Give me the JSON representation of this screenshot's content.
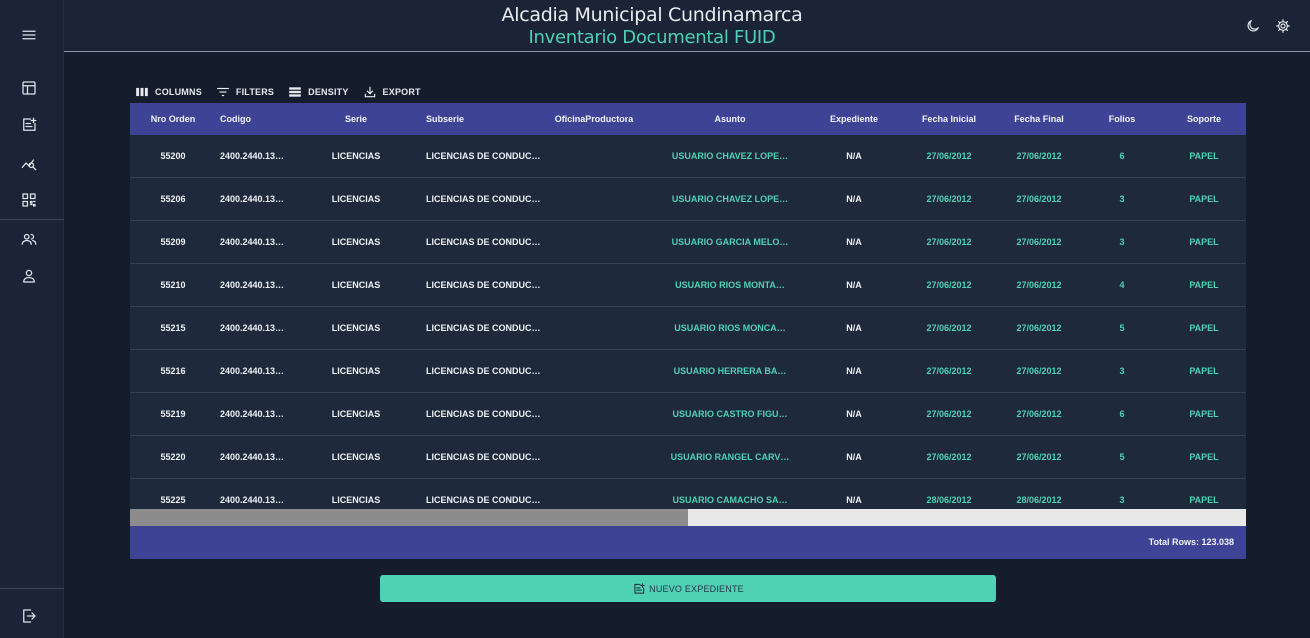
{
  "header": {
    "title": "Alcadia Municipal Cundinamarca",
    "subtitle": "Inventario Documental FUID"
  },
  "icons": {
    "menu": "menu-icon",
    "dashboard": "dashboard-icon",
    "new_record": "note-add-icon",
    "analytics": "chart-search-icon",
    "qr": "qr-code-icon",
    "users": "group-icon",
    "profile": "person-icon",
    "logout": "logout-icon",
    "theme": "moon-icon",
    "settings": "gear-icon"
  },
  "toolbar": {
    "columns_label": "COLUMNS",
    "filters_label": "FILTERS",
    "density_label": "DENSITY",
    "export_label": "EXPORT"
  },
  "table": {
    "columns": [
      "Nro Orden",
      "Codigo",
      "Serie",
      "Subserie",
      "OficinaProductora",
      "Asunto",
      "Expediente",
      "Fecha Inicial",
      "Fecha Final",
      "Folios",
      "Soporte"
    ],
    "rows": [
      [
        "55200",
        "2400.2440.13…",
        "LICENCIAS",
        "LICENCIAS DE CONDUC…",
        "",
        "USUARIO CHAVEZ LOPE…",
        "N/A",
        "27/06/2012",
        "27/06/2012",
        "6",
        "PAPEL"
      ],
      [
        "55206",
        "2400.2440.13…",
        "LICENCIAS",
        "LICENCIAS DE CONDUC…",
        "",
        "USUARIO CHAVEZ LOPE…",
        "N/A",
        "27/06/2012",
        "27/06/2012",
        "3",
        "PAPEL"
      ],
      [
        "55209",
        "2400.2440.13…",
        "LICENCIAS",
        "LICENCIAS DE CONDUC…",
        "",
        "USUARIO GARCIA MELO…",
        "N/A",
        "27/06/2012",
        "27/06/2012",
        "3",
        "PAPEL"
      ],
      [
        "55210",
        "2400.2440.13…",
        "LICENCIAS",
        "LICENCIAS DE CONDUC…",
        "",
        "USUARIO RIOS MONTA…",
        "N/A",
        "27/06/2012",
        "27/06/2012",
        "4",
        "PAPEL"
      ],
      [
        "55215",
        "2400.2440.13…",
        "LICENCIAS",
        "LICENCIAS DE CONDUC…",
        "",
        "USUARIO RIOS MONCA…",
        "N/A",
        "27/06/2012",
        "27/06/2012",
        "5",
        "PAPEL"
      ],
      [
        "55216",
        "2400.2440.13…",
        "LICENCIAS",
        "LICENCIAS DE CONDUC…",
        "",
        "USUARIO HERRERA BA…",
        "N/A",
        "27/06/2012",
        "27/06/2012",
        "3",
        "PAPEL"
      ],
      [
        "55219",
        "2400.2440.13…",
        "LICENCIAS",
        "LICENCIAS DE CONDUC…",
        "",
        "USUARIO CASTRO FIGU…",
        "N/A",
        "27/06/2012",
        "27/06/2012",
        "6",
        "PAPEL"
      ],
      [
        "55220",
        "2400.2440.13…",
        "LICENCIAS",
        "LICENCIAS DE CONDUC…",
        "",
        "USUARIO RANGEL CARV…",
        "N/A",
        "27/06/2012",
        "27/06/2012",
        "5",
        "PAPEL"
      ],
      [
        "55225",
        "2400.2440.13…",
        "LICENCIAS",
        "LICENCIAS DE CONDUC…",
        "",
        "USUARIO CAMACHO SA…",
        "N/A",
        "28/06/2012",
        "28/06/2012",
        "3",
        "PAPEL"
      ]
    ],
    "horizontal_scroll_fraction": 0.5,
    "total_rows": "Total Rows: 123.038"
  },
  "actions": {
    "new_label": "NUEVO EXPEDIENTE"
  },
  "colors": {
    "accent": "#4fd1b3",
    "header_bg": "#3f4396",
    "page_bg": "#151d2c"
  }
}
